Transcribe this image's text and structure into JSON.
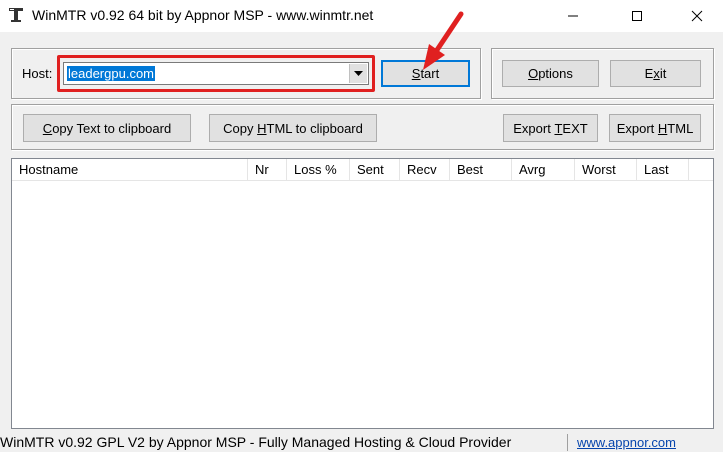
{
  "window": {
    "title": "WinMTR v0.92 64 bit by Appnor MSP - www.winmtr.net",
    "controls": {
      "minimize": "minimize-icon",
      "maximize": "maximize-icon",
      "close": "close-icon"
    }
  },
  "host": {
    "label": "Host:",
    "value": "leadergpu.com"
  },
  "buttons": {
    "start": {
      "pre": "",
      "key": "S",
      "post": "tart"
    },
    "options": {
      "pre": "",
      "key": "O",
      "post": "ptions"
    },
    "exit": {
      "pre": "E",
      "key": "x",
      "post": "it"
    },
    "copy_text": {
      "pre": "",
      "key": "C",
      "post": "opy Text to clipboard"
    },
    "copy_html": {
      "pre": "Copy ",
      "key": "H",
      "post": "TML to clipboard"
    },
    "export_text": {
      "pre": "Export ",
      "key": "T",
      "post": "EXT"
    },
    "export_html": {
      "pre": "Export ",
      "key": "H",
      "post": "TML"
    }
  },
  "table": {
    "columns": [
      "Hostname",
      "Nr",
      "Loss %",
      "Sent",
      "Recv",
      "Best",
      "Avrg",
      "Worst",
      "Last"
    ],
    "rows": []
  },
  "status": {
    "text": "WinMTR v0.92 GPL V2 by Appnor MSP - Fully Managed Hosting & Cloud Provider",
    "link": "www.appnor.com"
  },
  "colors": {
    "highlight_box": "#e02020",
    "selection": "#0078d7",
    "link": "#0645ad"
  }
}
